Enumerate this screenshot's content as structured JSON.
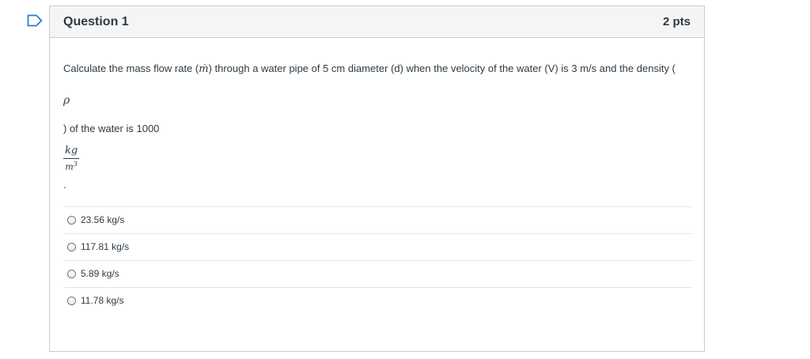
{
  "question": {
    "title": "Question 1",
    "points": "2 pts",
    "text_part1": "Calculate the mass flow rate (",
    "mdot_symbol": "ṁ",
    "text_part2": ") through a water pipe of 5 cm diameter (d) when the velocity of the water (V) is 3 m/s and the density (",
    "rho_symbol": "ρ",
    "text_part3": ") of the water is 1000",
    "unit_numerator": "kg",
    "unit_denominator": "m",
    "unit_exponent": "3",
    "text_part4": "."
  },
  "answers": [
    {
      "label": "23.56 kg/s",
      "selected": false
    },
    {
      "label": "117.81 kg/s",
      "selected": false
    },
    {
      "label": "5.89 kg/s",
      "selected": false
    },
    {
      "label": "11.78 kg/s",
      "selected": false
    }
  ],
  "colors": {
    "flag_outline": "#2d7bd4",
    "border": "#c7cdd1",
    "header_bg": "#f5f5f5",
    "text": "#2d3b45"
  },
  "icons": {
    "flag": "bookmark-flag-icon"
  }
}
